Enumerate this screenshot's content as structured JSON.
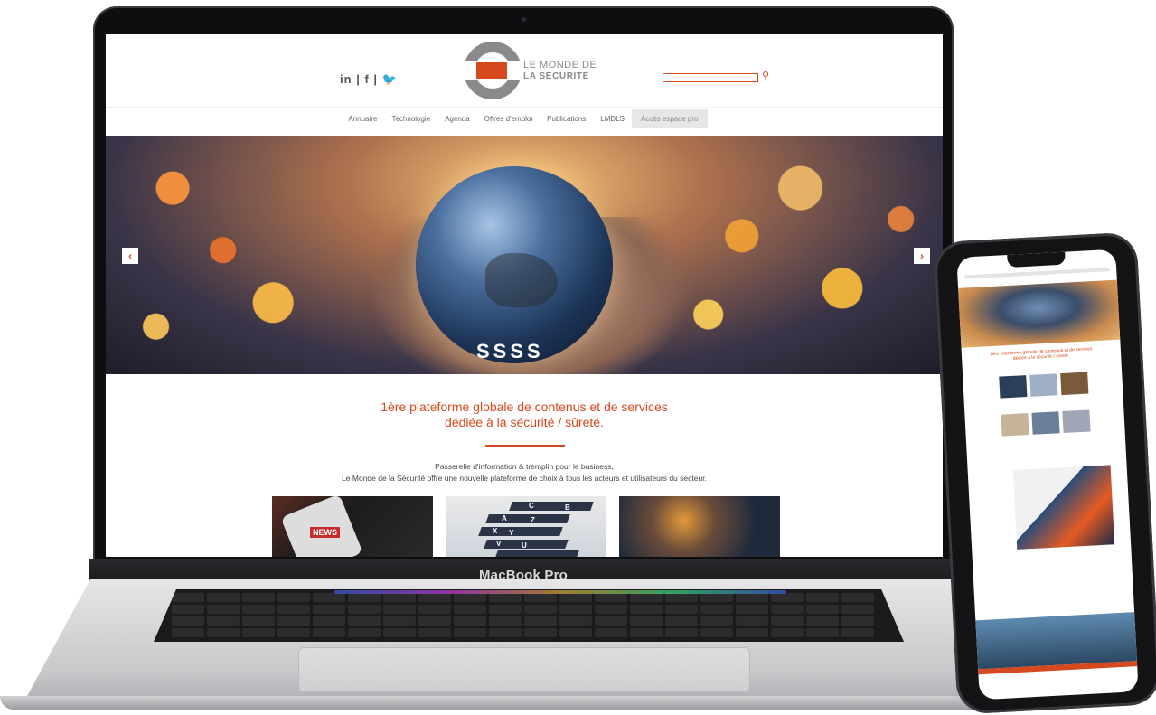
{
  "laptop": {
    "model_label": "MacBook Pro"
  },
  "site": {
    "social": {
      "linkedin": "in",
      "separator": "|",
      "facebook": "f",
      "twitter": "🐦"
    },
    "logo": {
      "line1": "LE MONDE DE",
      "line2": "LA SÉCURITÉ"
    },
    "search": {
      "value": "",
      "icon": "search-icon"
    },
    "nav": {
      "items": [
        "Annuaire",
        "Technologie",
        "Agenda",
        "Offres d'emploi",
        "Publications",
        "LMDLS"
      ],
      "pro_button": "Accès espace pro"
    },
    "hero": {
      "prev_arrow": "‹",
      "next_arrow": "›",
      "brand_mark": "SSSS"
    },
    "headline": {
      "line1": "1ère plateforme globale de contenus et de services",
      "line2": "dédiée à la sécurité / sûreté."
    },
    "intro": {
      "line1": "Passerelle d'information & tremplin pour le business,",
      "line2": "Le Monde de la Sécurité offre une nouvelle plateforme de choix à tous les acteurs et utilisateurs du secteur."
    },
    "thumbnails": {
      "news_tag": "NEWS",
      "tab_letters": [
        "C",
        "B",
        "A",
        "Z",
        "X",
        "Y",
        "V",
        "U"
      ]
    }
  },
  "colors": {
    "accent": "#d6491e",
    "logo_gray": "#8a8a8c"
  }
}
